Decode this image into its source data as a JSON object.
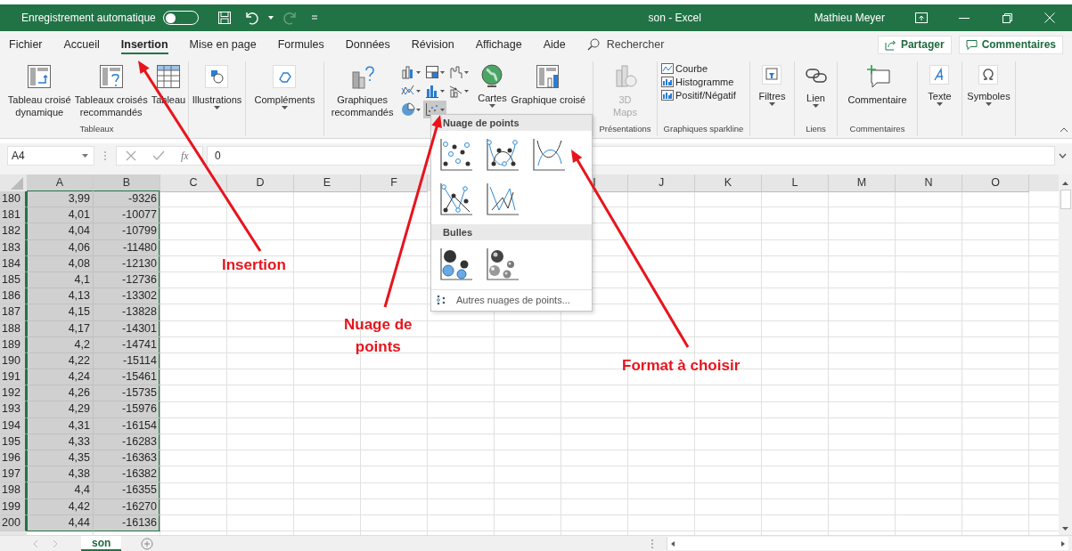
{
  "title_bar": {
    "autosave_label": "Enregistrement automatique",
    "autosave_on": false,
    "document_title": "son  -  Excel",
    "user": "Mathieu Meyer"
  },
  "menu_tabs": [
    {
      "label": "Fichier",
      "selected": false
    },
    {
      "label": "Accueil",
      "selected": false
    },
    {
      "label": "Insertion",
      "selected": true
    },
    {
      "label": "Mise en page",
      "selected": false
    },
    {
      "label": "Formules",
      "selected": false
    },
    {
      "label": "Données",
      "selected": false
    },
    {
      "label": "Révision",
      "selected": false
    },
    {
      "label": "Affichage",
      "selected": false
    },
    {
      "label": "Aide",
      "selected": false
    }
  ],
  "search": {
    "placeholder": "Rechercher"
  },
  "share_button": "Partager",
  "comments_button": "Commentaires",
  "ribbon": {
    "tableaux": {
      "label": "Tableaux",
      "buttons": [
        {
          "lines": [
            "Tableau croisé",
            "dynamique"
          ]
        },
        {
          "lines": [
            "Tableaux croisés",
            "recommandés"
          ]
        },
        {
          "lines": [
            "Tableau"
          ]
        }
      ]
    },
    "illustrations": "Illustrations",
    "complements": "Compléments",
    "graphiques": {
      "recommended": [
        "Graphiques",
        "recommandés"
      ],
      "scatter_pressed": true,
      "maps": "Cartes",
      "pivot_chart": "Graphique croisé"
    },
    "presentations": {
      "label": "Présentations",
      "button": [
        "3D",
        "Maps"
      ],
      "disabled": true
    },
    "sparklines": {
      "label": "Graphiques sparkline",
      "items": [
        "Courbe",
        "Histogramme",
        "Positif/Négatif"
      ]
    },
    "filtres": "Filtres",
    "liens": {
      "label": "Liens",
      "button": "Lien"
    },
    "commentaires": {
      "label": "Commentaires",
      "button": "Commentaire"
    },
    "texte": "Texte",
    "symboles": "Symboles"
  },
  "formula_bar": {
    "name_box": "A4",
    "function_label": "fx",
    "value": "0"
  },
  "columns_left": [
    "A",
    "B",
    "C",
    "D",
    "E",
    "F"
  ],
  "columns_right": [
    "I",
    "J",
    "K",
    "L",
    "M",
    "N",
    "O"
  ],
  "rows": [
    {
      "n": "180",
      "a": "3,99",
      "b": "-9326",
      "selected": true
    },
    {
      "n": "181",
      "a": "4,01",
      "b": "-10077",
      "selected": true
    },
    {
      "n": "182",
      "a": "4,04",
      "b": "-10799",
      "selected": true
    },
    {
      "n": "183",
      "a": "4,06",
      "b": "-11480",
      "selected": true
    },
    {
      "n": "184",
      "a": "4,08",
      "b": "-12130",
      "selected": true
    },
    {
      "n": "185",
      "a": "4,1",
      "b": "-12736",
      "selected": true
    },
    {
      "n": "186",
      "a": "4,13",
      "b": "-13302",
      "selected": true
    },
    {
      "n": "187",
      "a": "4,15",
      "b": "-13828",
      "selected": true
    },
    {
      "n": "188",
      "a": "4,17",
      "b": "-14301",
      "selected": true
    },
    {
      "n": "189",
      "a": "4,2",
      "b": "-14741",
      "selected": true
    },
    {
      "n": "190",
      "a": "4,22",
      "b": "-15114",
      "selected": true
    },
    {
      "n": "191",
      "a": "4,24",
      "b": "-15461",
      "selected": true
    },
    {
      "n": "192",
      "a": "4,26",
      "b": "-15735",
      "selected": true
    },
    {
      "n": "193",
      "a": "4,29",
      "b": "-15976",
      "selected": true
    },
    {
      "n": "194",
      "a": "4,31",
      "b": "-16154",
      "selected": true
    },
    {
      "n": "195",
      "a": "4,33",
      "b": "-16283",
      "selected": true
    },
    {
      "n": "196",
      "a": "4,35",
      "b": "-16363",
      "selected": true
    },
    {
      "n": "197",
      "a": "4,38",
      "b": "-16382",
      "selected": true
    },
    {
      "n": "198",
      "a": "4,4",
      "b": "-16355",
      "selected": true
    },
    {
      "n": "199",
      "a": "4,42",
      "b": "-16270",
      "selected": true
    },
    {
      "n": "200",
      "a": "4,44",
      "b": "-16136",
      "selected": true
    }
  ],
  "scatter_menu": {
    "sections": [
      {
        "title": "Nuage de points",
        "items": [
          {
            "kind": "markers"
          },
          {
            "kind": "smooth-markers"
          },
          {
            "kind": "smooth"
          },
          {
            "kind": "straight-markers"
          },
          {
            "kind": "straight"
          }
        ]
      },
      {
        "title": "Bulles",
        "items": [
          {
            "kind": "bubble"
          },
          {
            "kind": "bubble-3d"
          }
        ]
      }
    ],
    "more": "Autres nuages de points..."
  },
  "annotations": [
    {
      "lines": [
        "Insertion"
      ]
    },
    {
      "lines": [
        "Nuage de",
        "points"
      ]
    },
    {
      "lines": [
        "Format à choisir"
      ]
    }
  ],
  "sheet_tabs": [
    {
      "label": "son",
      "selected": true
    }
  ]
}
